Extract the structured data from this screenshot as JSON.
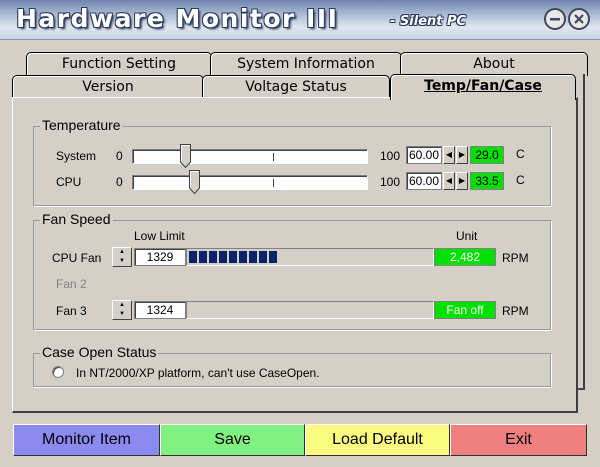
{
  "window": {
    "title": "Hardware Monitor III",
    "subtitle": "- Silent PC",
    "minimize_icon": "minus-circle-icon",
    "close_icon": "x-circle-icon"
  },
  "tabs": {
    "back_row": [
      "Function Setting",
      "System Information",
      "About"
    ],
    "front_row": [
      "Version",
      "Voltage Status",
      "Temp/Fan/Case"
    ],
    "active": "Temp/Fan/Case"
  },
  "temperature": {
    "title": "Temperature",
    "rows": [
      {
        "label": "System",
        "min": "0",
        "max": "100",
        "threshold": "60.00",
        "current": "29.0",
        "unit": "C",
        "slider_fraction": 0.21
      },
      {
        "label": "CPU",
        "min": "0",
        "max": "100",
        "threshold": "60.00",
        "current": "33.5",
        "unit": "C",
        "slider_fraction": 0.25
      }
    ]
  },
  "fan": {
    "title": "Fan Speed",
    "low_limit_header": "Low Limit",
    "unit_header": "Unit",
    "rows": [
      {
        "label": "CPU Fan",
        "low_limit": "1329",
        "reading": "2,482",
        "unit": "RPM",
        "fill_fraction": 0.37
      },
      {
        "label": "Fan 2"
      },
      {
        "label": "Fan 3",
        "low_limit": "1324",
        "reading": "Fan off",
        "unit": "RPM",
        "fill_fraction": 0
      }
    ]
  },
  "case": {
    "title": "Case Open Status",
    "message": "In NT/2000/XP platform, can't use CaseOpen."
  },
  "buttons": {
    "monitor_item": "Monitor Item",
    "save": "Save",
    "load_default": "Load Default",
    "exit": "Exit"
  },
  "colors": {
    "monitor_item": "#8a8af0",
    "save": "#80f080",
    "load_default": "#fafa80",
    "exit": "#f08080",
    "reading": "#00e000",
    "progress": "#0a246a"
  }
}
